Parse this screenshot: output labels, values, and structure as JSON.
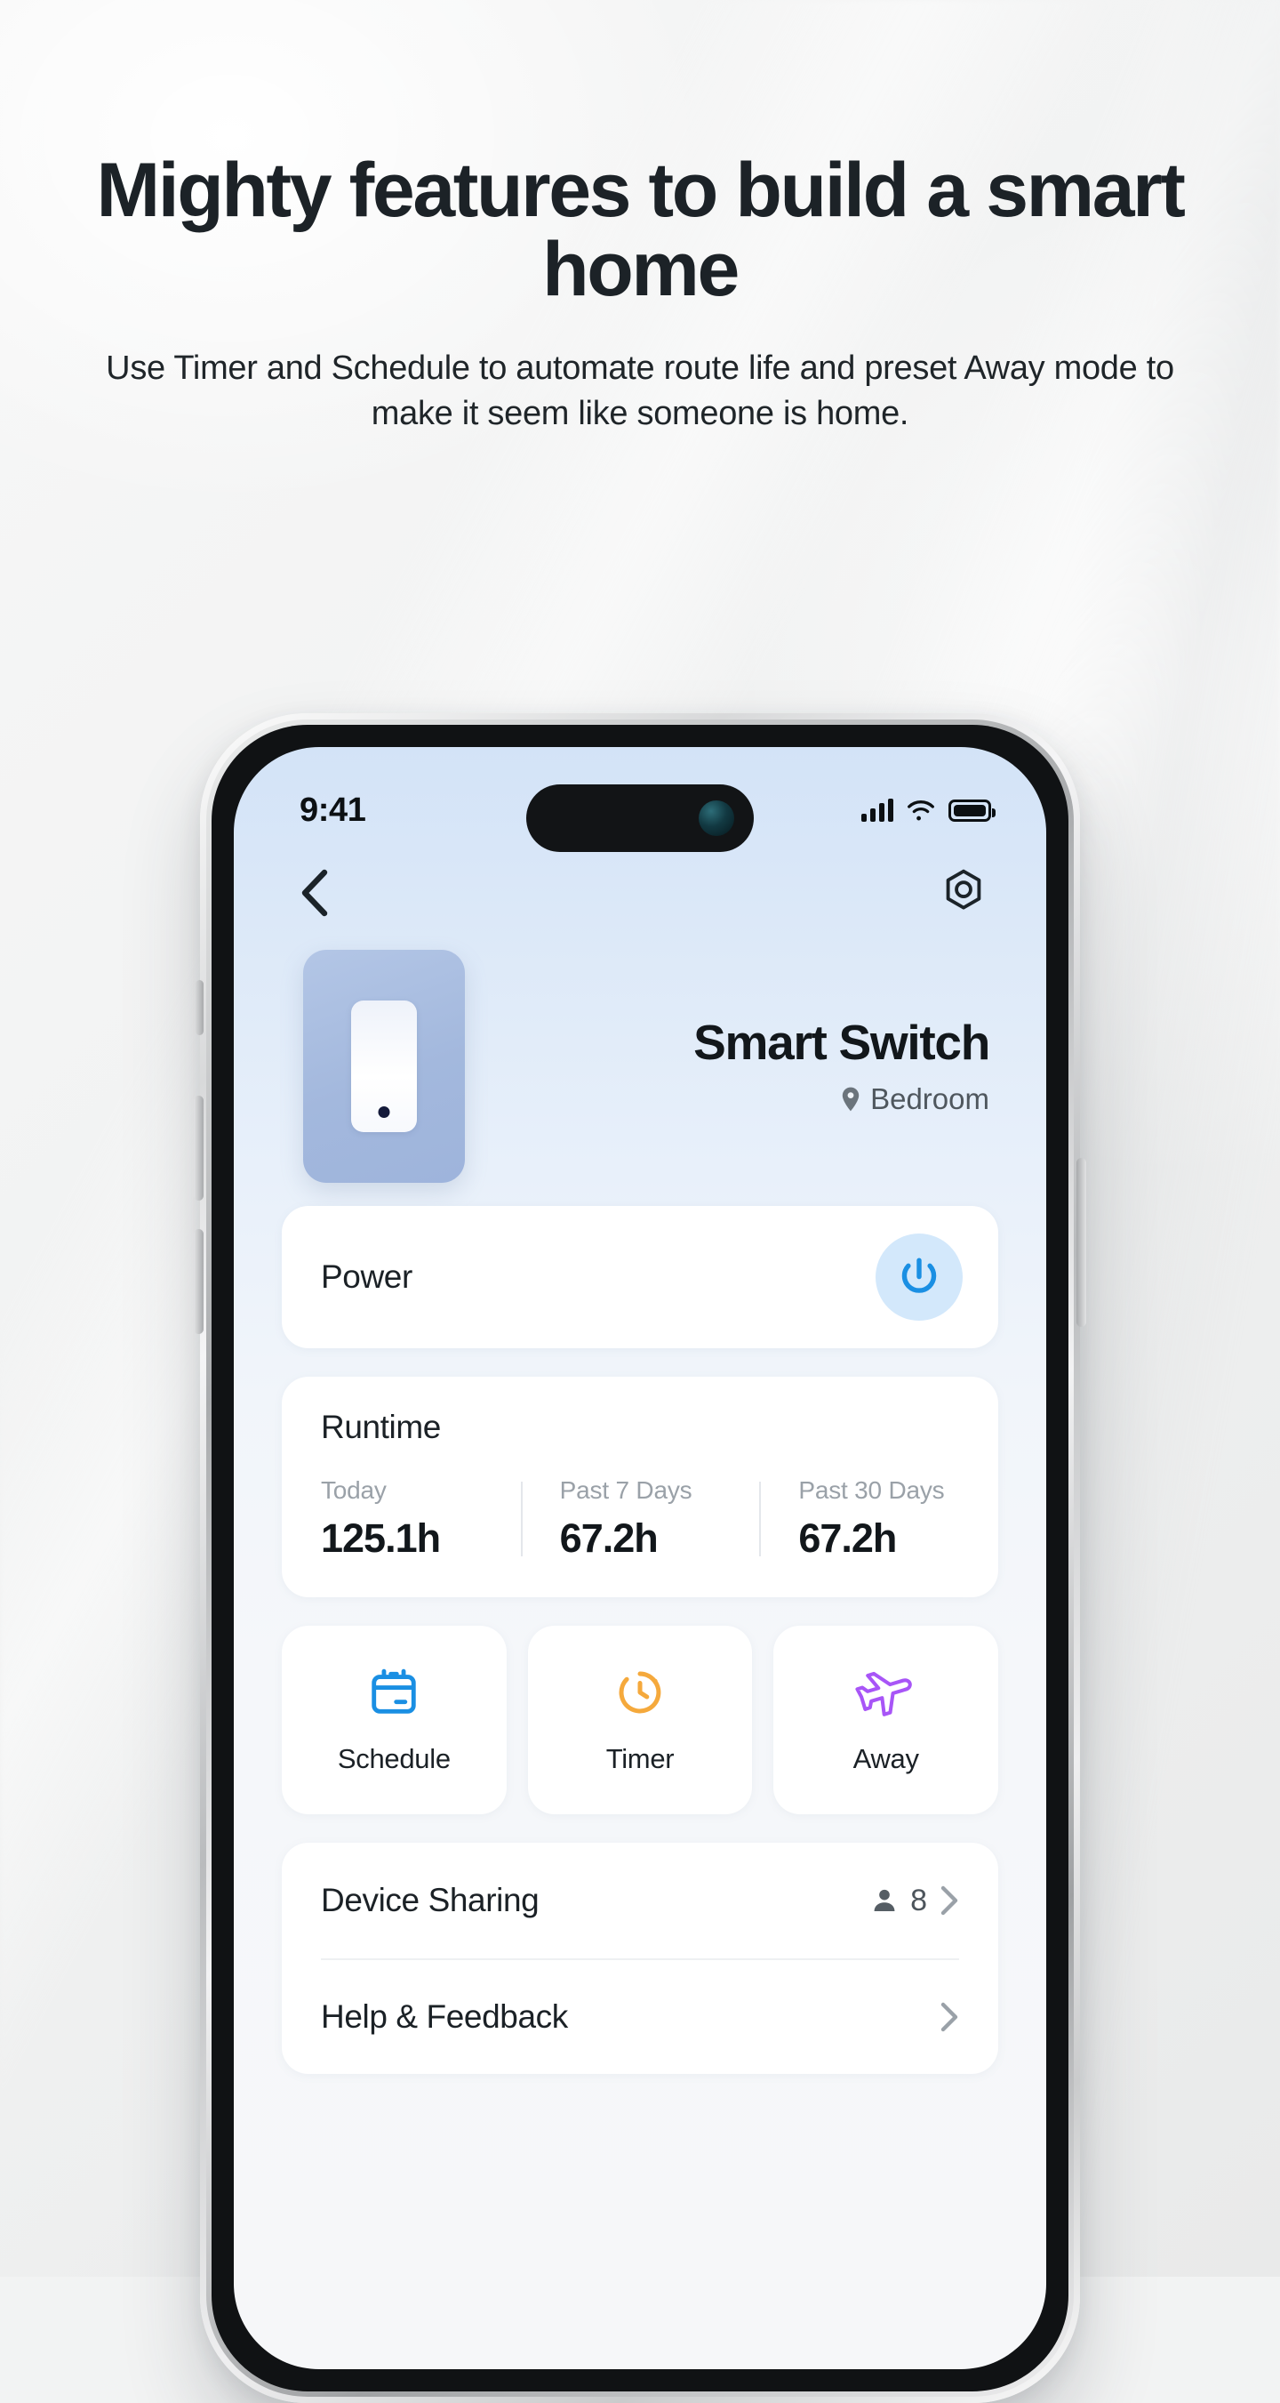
{
  "hero": {
    "headline": "Mighty features to build a smart home",
    "subcopy": "Use Timer and Schedule to automate route life and preset Away mode to make it seem like someone is home."
  },
  "phone": {
    "statusbar": {
      "time": "9:41",
      "signal_icon": "cellular-bars-icon",
      "wifi_icon": "wifi-icon",
      "battery_icon": "battery-full-icon"
    },
    "nav": {
      "back_icon": "back-chevron-icon",
      "settings_icon": "gear-icon"
    },
    "device": {
      "image_icon": "smart-switch-illustration",
      "title": "Smart Switch",
      "room": "Bedroom",
      "room_icon": "location-pin-icon"
    },
    "power_card": {
      "label": "Power",
      "button_icon": "power-icon",
      "accent": "#1a8fe3",
      "button_bg": "#d3e8fb"
    },
    "runtime_card": {
      "title": "Runtime",
      "stats": [
        {
          "label": "Today",
          "value": "125.1h"
        },
        {
          "label": "Past 7 Days",
          "value": "67.2h"
        },
        {
          "label": "Past 30 Days",
          "value": "67.2h"
        }
      ]
    },
    "tiles": [
      {
        "label": "Schedule",
        "icon": "calendar-icon",
        "color": "#1a8fe3"
      },
      {
        "label": "Timer",
        "icon": "clock-timer-icon",
        "color": "#f5a93c"
      },
      {
        "label": "Away",
        "icon": "airplane-icon",
        "color": "#a855f7"
      }
    ],
    "list": [
      {
        "label": "Device Sharing",
        "count": "8",
        "count_icon": "person-icon",
        "chevron": "chevron-right-icon"
      },
      {
        "label": "Help & Feedback",
        "count": "",
        "count_icon": "",
        "chevron": "chevron-right-icon"
      }
    ]
  }
}
